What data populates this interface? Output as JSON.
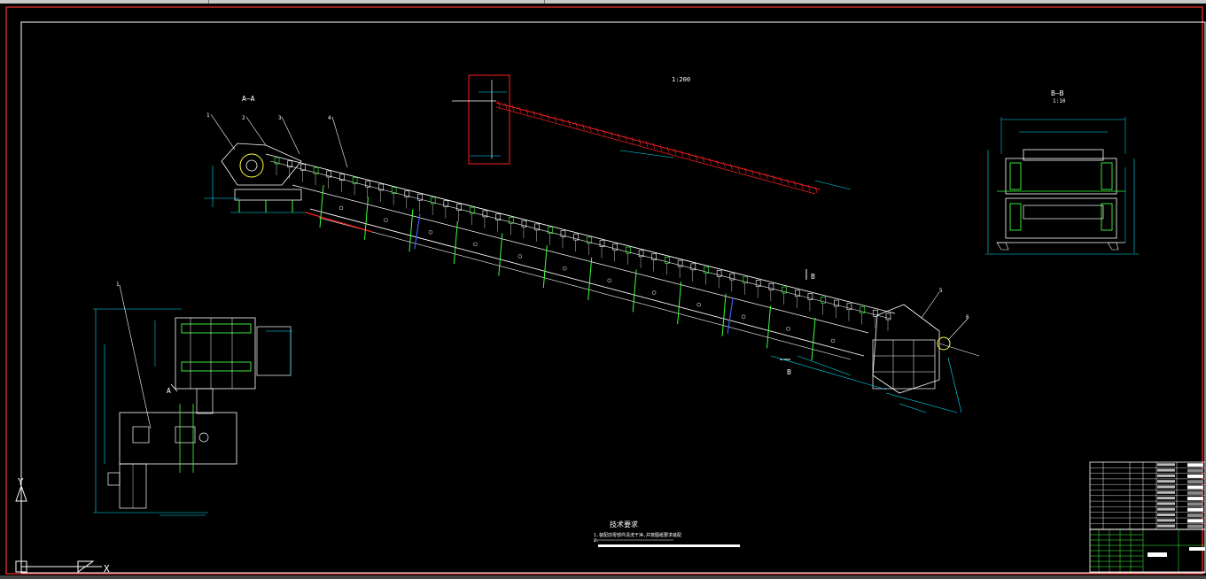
{
  "drawing": {
    "scale_main": "1:200",
    "section_aa": "A—A",
    "section_bb": "B—B",
    "scale_bb": "1:10",
    "view_mark_a": "A",
    "view_mark_b": "B",
    "axis_x": "X",
    "axis_y": "Y",
    "tech_title": "技术要求",
    "tech_line1": "1.装配前零部件清洗干净,并按图纸要求装配",
    "tech_line2": "2.",
    "part_balloons": [
      "1",
      "2",
      "3",
      "4",
      "5",
      "6"
    ]
  },
  "colors": {
    "background": "#000000",
    "frame": "#ffffff",
    "outer_frame": "#ff3030",
    "geometry": "#ffffff",
    "dimension": "#00e5ff",
    "accent_green": "#3cff3c",
    "section_red": "#ff2020",
    "blue_mark": "#3a5bff",
    "magenta": "#ff40ff",
    "yellow": "#ffff40"
  },
  "icons": [
    "ucs-axis-icon"
  ]
}
